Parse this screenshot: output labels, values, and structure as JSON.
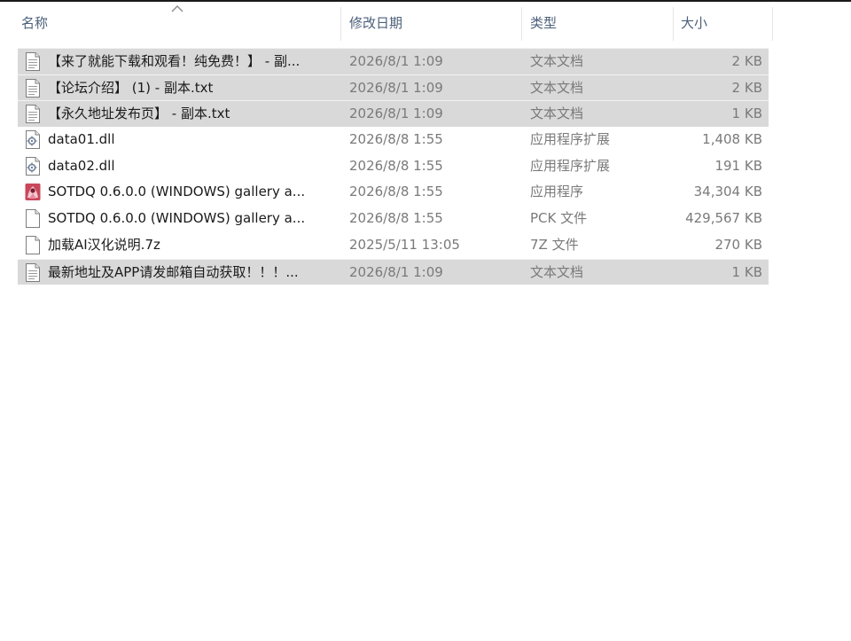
{
  "columns": {
    "name": "名称",
    "date": "修改日期",
    "type": "类型",
    "size": "大小"
  },
  "files": [
    {
      "name": "【来了就能下载和观看！纯免费！】 - 副...",
      "date": "2026/8/1 1:09",
      "type": "文本文档",
      "size": "2 KB",
      "icon": "text-file-icon",
      "selected": true
    },
    {
      "name": "【论坛介绍】 (1) - 副本.txt",
      "date": "2026/8/1 1:09",
      "type": "文本文档",
      "size": "2 KB",
      "icon": "text-file-icon",
      "selected": true
    },
    {
      "name": "【永久地址发布页】 - 副本.txt",
      "date": "2026/8/1 1:09",
      "type": "文本文档",
      "size": "1 KB",
      "icon": "text-file-icon",
      "selected": true
    },
    {
      "name": "data01.dll",
      "date": "2026/8/8 1:55",
      "type": "应用程序扩展",
      "size": "1,408 KB",
      "icon": "dll-file-icon",
      "selected": false
    },
    {
      "name": "data02.dll",
      "date": "2026/8/8 1:55",
      "type": "应用程序扩展",
      "size": "191 KB",
      "icon": "dll-file-icon",
      "selected": false
    },
    {
      "name": "SOTDQ 0.6.0.0 (WINDOWS) gallery a...",
      "date": "2026/8/8 1:55",
      "type": "应用程序",
      "size": "34,304 KB",
      "icon": "app-exe-icon",
      "selected": false
    },
    {
      "name": "SOTDQ 0.6.0.0 (WINDOWS) gallery a...",
      "date": "2026/8/8 1:55",
      "type": "PCK 文件",
      "size": "429,567 KB",
      "icon": "blank-file-icon",
      "selected": false
    },
    {
      "name": "加载AI汉化说明.7z",
      "date": "2025/5/11 13:05",
      "type": "7Z 文件",
      "size": "270 KB",
      "icon": "blank-file-icon",
      "selected": false
    },
    {
      "name": "最新地址及APP请发邮箱自动获取！！！...",
      "date": "2026/8/1 1:09",
      "type": "文本文档",
      "size": "1 KB",
      "icon": "text-file-icon",
      "selected": true
    }
  ]
}
